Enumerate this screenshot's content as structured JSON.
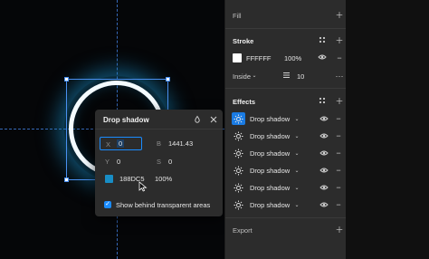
{
  "canvas": {
    "accent_color": "#188DC5",
    "guide_color": "#3f7ad6"
  },
  "drop_shadow": {
    "title": "Drop shadow",
    "fields": {
      "x": {
        "label": "X",
        "value": "0"
      },
      "y": {
        "label": "Y",
        "value": "0"
      },
      "b": {
        "label": "B",
        "value": "1441.43"
      },
      "s": {
        "label": "S",
        "value": "0"
      }
    },
    "color_hex": "188DC5",
    "opacity": "100%",
    "checkbox_label": "Show behind transparent areas",
    "checkbox_checked": true
  },
  "panel": {
    "fill": {
      "title": "Fill"
    },
    "stroke": {
      "title": "Stroke",
      "color_hex": "FFFFFF",
      "opacity": "100%",
      "position": "Inside",
      "weight": "10"
    },
    "effects": {
      "title": "Effects",
      "items": [
        {
          "label": "Drop shadow",
          "selected": true
        },
        {
          "label": "Drop shadow",
          "selected": false
        },
        {
          "label": "Drop shadow",
          "selected": false
        },
        {
          "label": "Drop shadow",
          "selected": false
        },
        {
          "label": "Drop shadow",
          "selected": false
        },
        {
          "label": "Drop shadow",
          "selected": false
        }
      ]
    },
    "export": {
      "title": "Export"
    }
  }
}
